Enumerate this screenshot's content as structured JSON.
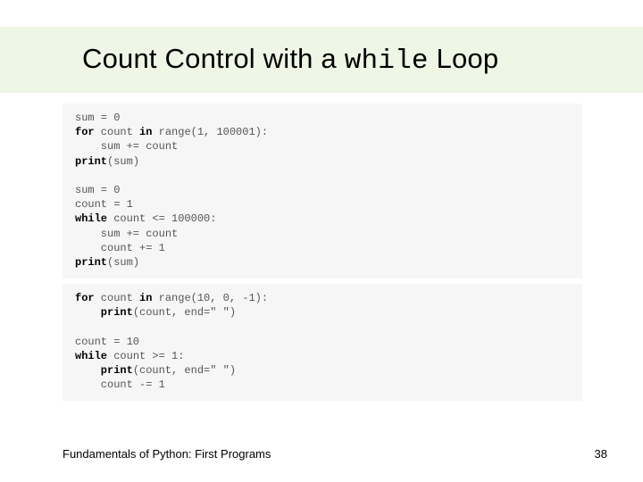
{
  "title": {
    "prefix": "Count Control with a ",
    "mono": "while",
    "suffix": " Loop"
  },
  "code1": {
    "l0a": "sum = 0",
    "l1a": "for",
    "l1b": " count ",
    "l1c": "in",
    "l1d": " range(1, 100001):",
    "l2a": "    sum += count",
    "l3a": "print",
    "l3b": "(sum)",
    "l5a": "sum = 0",
    "l6a": "count = 1",
    "l7a": "while",
    "l7b": " count <= 100000:",
    "l8a": "    sum += count",
    "l9a": "    count += 1",
    "l10a": "print",
    "l10b": "(sum)"
  },
  "code2": {
    "l0a": "for",
    "l0b": " count ",
    "l0c": "in",
    "l0d": " range(10, 0, -1):",
    "l1a": "    print",
    "l1b": "(count, end=\" \")",
    "l3a": "count = 10",
    "l4a": "while",
    "l4b": " count >= 1:",
    "l5a": "    print",
    "l5b": "(count, end=\" \")",
    "l6a": "    count -= 1"
  },
  "footer": {
    "book": "Fundamentals of Python: First Programs",
    "page": "38"
  }
}
